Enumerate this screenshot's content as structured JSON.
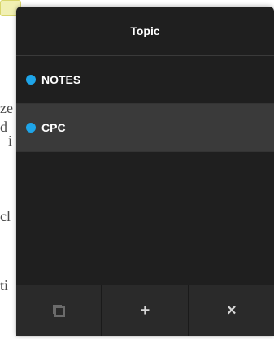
{
  "background": {
    "text_fragments": [
      "ze",
      "d",
      "i",
      "cl",
      "ti"
    ]
  },
  "panel": {
    "title": "Topic",
    "items": [
      {
        "label": "NOTES",
        "dot_color": "#1ea5e9",
        "selected": false
      },
      {
        "label": "CPC",
        "dot_color": "#1ea5e9",
        "selected": true
      }
    ]
  },
  "toolbar": {
    "duplicate_icon": "copy-icon",
    "add_label": "+",
    "delete_label": "×"
  }
}
